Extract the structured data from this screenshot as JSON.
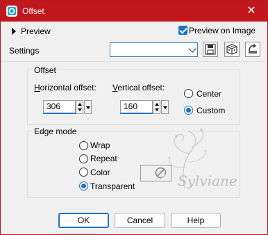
{
  "window": {
    "title": "Offset",
    "close_glyph": "✕"
  },
  "preview": {
    "label": "Preview",
    "preview_on_image_label": "Preview on Image",
    "preview_on_image_checked": true
  },
  "settings": {
    "label": "Settings",
    "value": ""
  },
  "offset_group": {
    "title": "Offset",
    "horizontal": {
      "label": "Horizontal offset:",
      "accel": "H",
      "rest": "orizontal offset:",
      "value": "306"
    },
    "vertical": {
      "label": "Vertical offset:",
      "accel": "V",
      "rest": "ertical offset:",
      "value": "160"
    },
    "center_label": "Center",
    "custom_label": "Custom",
    "selected": "Custom"
  },
  "edge_group": {
    "title": "Edge mode",
    "options": [
      "Wrap",
      "Repeat",
      "Color",
      "Transparent"
    ],
    "selected": "Transparent"
  },
  "watermark_text": "Sylviane",
  "buttons": {
    "ok": "OK",
    "cancel": "Cancel",
    "help": "Help"
  },
  "colors": {
    "titlebar": "#c1171d",
    "accent": "#1a73c8"
  },
  "icons": [
    "offset-app-icon",
    "close-icon",
    "expand-triangle-icon",
    "save-preset-icon",
    "randomize-icon",
    "reset-icon",
    "no-color-icon"
  ]
}
